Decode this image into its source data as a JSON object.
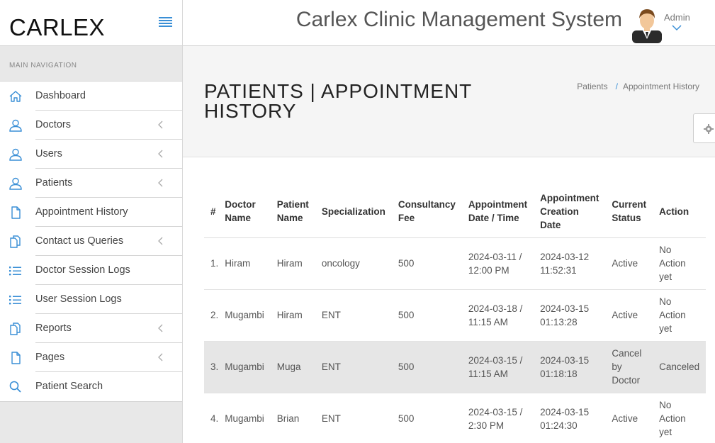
{
  "brand": {
    "name": "CARLEX"
  },
  "header": {
    "title": "Carlex Clinic Management System",
    "user": "Admin"
  },
  "sidebar": {
    "section_label": "MAIN NAVIGATION",
    "items": [
      {
        "label": "Dashboard",
        "icon": "home-icon",
        "has_submenu": false
      },
      {
        "label": "Doctors",
        "icon": "user-icon",
        "has_submenu": true
      },
      {
        "label": "Users",
        "icon": "user-icon",
        "has_submenu": true
      },
      {
        "label": "Patients",
        "icon": "user-icon",
        "has_submenu": true
      },
      {
        "label": "Appointment History",
        "icon": "file-icon",
        "has_submenu": false
      },
      {
        "label": "Contact us Queries",
        "icon": "files-icon",
        "has_submenu": true
      },
      {
        "label": "Doctor Session Logs",
        "icon": "list-icon",
        "has_submenu": false
      },
      {
        "label": "User Session Logs",
        "icon": "list-icon",
        "has_submenu": false
      },
      {
        "label": "Reports",
        "icon": "files-icon",
        "has_submenu": true
      },
      {
        "label": "Pages",
        "icon": "file-icon",
        "has_submenu": true
      },
      {
        "label": "Patient Search",
        "icon": "search-icon",
        "has_submenu": false
      }
    ]
  },
  "page": {
    "title": "PATIENTS | APPOINTMENT HISTORY",
    "breadcrumb": [
      "Patients",
      "/",
      "Appointment History"
    ]
  },
  "table": {
    "headers": [
      "#",
      "Doctor Name",
      "Patient Name",
      "Specialization",
      "Consultancy Fee",
      "Appointment Date / Time",
      "Appointment Creation Date",
      "Current Status",
      "Action"
    ],
    "rows": [
      [
        "1.",
        "Hiram",
        "Hiram",
        "oncology",
        "500",
        "2024-03-11 / 12:00 PM",
        "2024-03-12 11:52:31",
        "Active",
        "No Action yet"
      ],
      [
        "2.",
        "Mugambi",
        "Hiram",
        "ENT",
        "500",
        "2024-03-18 / 11:15 AM",
        "2024-03-15 01:13:28",
        "Active",
        "No Action yet"
      ],
      [
        "3.",
        "Mugambi",
        "Muga",
        "ENT",
        "500",
        "2024-03-15 / 11:15 AM",
        "2024-03-15 01:18:18",
        "Cancel by Doctor",
        "Canceled"
      ],
      [
        "4.",
        "Mugambi",
        "Brian",
        "ENT",
        "500",
        "2024-03-15 / 2:30 PM",
        "2024-03-15 01:24:30",
        "Active",
        "No Action yet"
      ]
    ],
    "highlighted_row": 2
  },
  "colors": {
    "accent": "#3a8fd6",
    "sidebar_bg": "#e8e8e8",
    "header_bg": "#f5f5f5"
  }
}
